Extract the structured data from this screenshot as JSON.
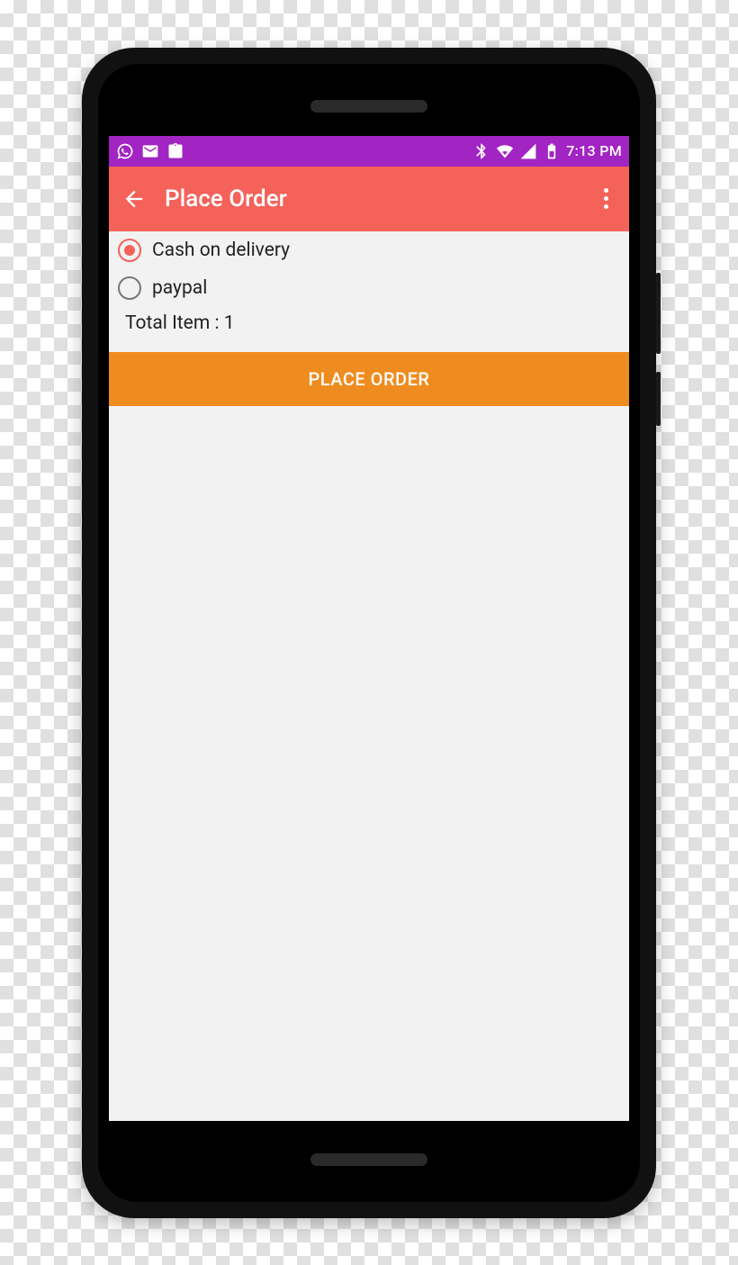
{
  "status_bar": {
    "time": "7:13 PM"
  },
  "app_bar": {
    "title": "Place Order"
  },
  "payment_options": [
    {
      "label": "Cash on delivery",
      "selected": true
    },
    {
      "label": "paypal",
      "selected": false
    }
  ],
  "total_line": "Total Item :  1",
  "cta": "PLACE ORDER"
}
